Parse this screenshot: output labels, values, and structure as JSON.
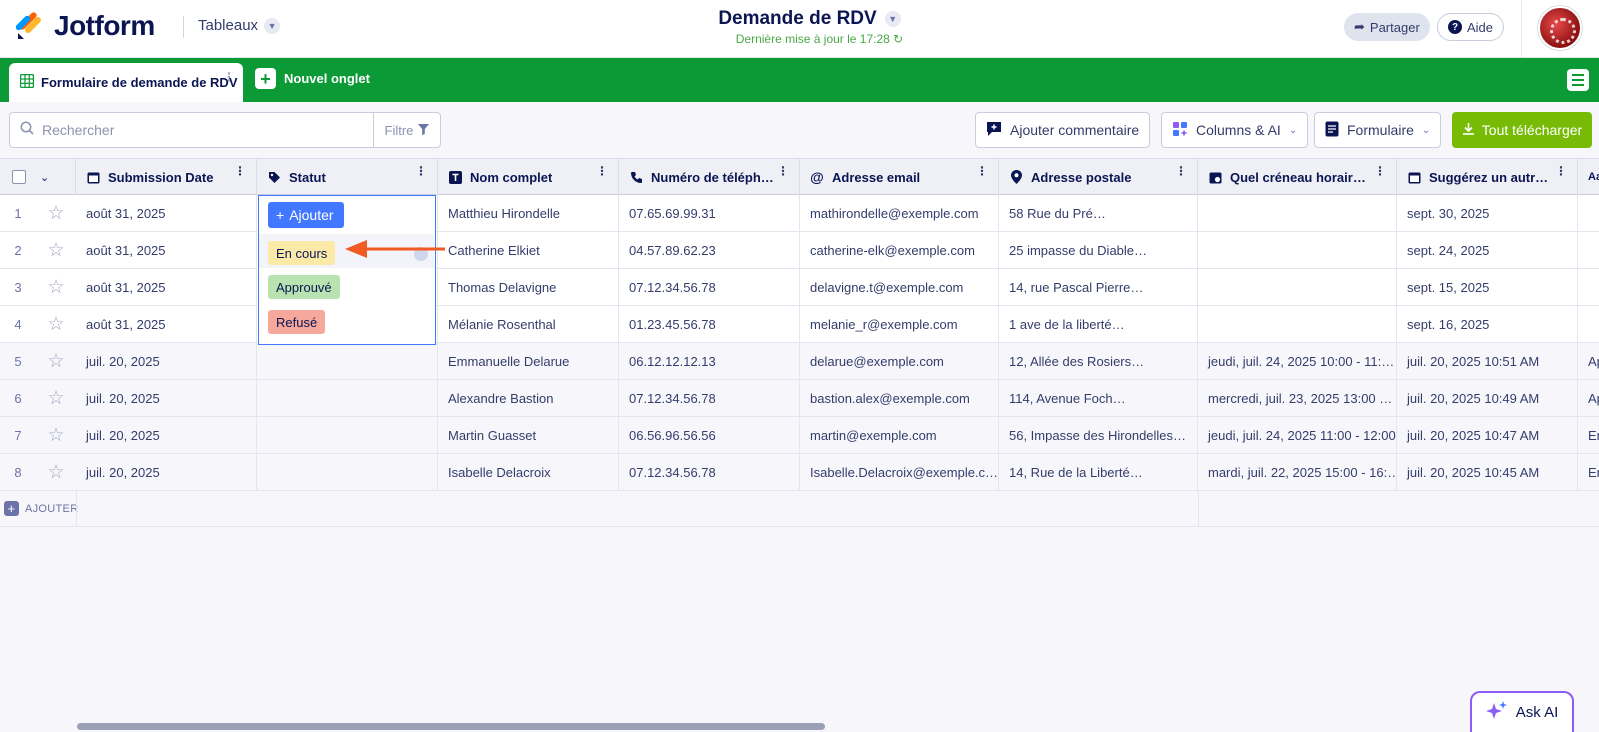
{
  "app": {
    "brand": "Jotform",
    "section": "Tableaux"
  },
  "doc": {
    "title": "Demande de RDV",
    "subtitle": "Dernière mise à jour le 17:28"
  },
  "header": {
    "share_label": "Partager",
    "help_label": "Aide"
  },
  "tabs": {
    "active_label": "Formulaire de demande de RDV",
    "new_tab_label": "Nouvel onglet"
  },
  "toolbar": {
    "search_placeholder": "Rechercher",
    "filter_label": "Filtre",
    "comment_label": "Ajouter commentaire",
    "columns_label": "Columns & AI",
    "form_label": "Formulaire",
    "download_label": "Tout télécharger"
  },
  "columns": [
    {
      "label": "Submission Date",
      "icon": "calendar-icon"
    },
    {
      "label": "Statut",
      "icon": "tag-icon"
    },
    {
      "label": "Nom complet",
      "icon": "text-icon"
    },
    {
      "label": "Numéro de téléph…",
      "icon": "phone-icon"
    },
    {
      "label": "Adresse email",
      "icon": "at-icon"
    },
    {
      "label": "Adresse postale",
      "icon": "location-icon"
    },
    {
      "label": "Quel créneau horaire…",
      "icon": "calendar-clock-icon"
    },
    {
      "label": "Suggérez un autr…",
      "icon": "calendar-icon"
    },
    {
      "label": "Aa",
      "icon": ""
    }
  ],
  "rows": [
    {
      "num": "1",
      "date": "août 31, 2025",
      "name": "Matthieu Hirondelle",
      "phone": "07.65.69.99.31",
      "email": "mathirondelle@exemple.com",
      "address": "58 Rue du Pré…",
      "slot": "",
      "suggest": "sept. 30, 2025",
      "extra": ""
    },
    {
      "num": "2",
      "date": "août 31, 2025",
      "name": "Catherine Elkiet",
      "phone": "04.57.89.62.23",
      "email": "catherine-elk@exemple.com",
      "address": "25 impasse du Diable…",
      "slot": "",
      "suggest": "sept. 24, 2025",
      "extra": ""
    },
    {
      "num": "3",
      "date": "août 31, 2025",
      "name": "Thomas Delavigne",
      "phone": "07.12.34.56.78",
      "email": "delavigne.t@exemple.com",
      "address": "14, rue Pascal Pierre…",
      "slot": "",
      "suggest": "sept. 15, 2025",
      "extra": ""
    },
    {
      "num": "4",
      "date": "août 31, 2025",
      "name": "Mélanie Rosenthal",
      "phone": "01.23.45.56.78",
      "email": "melanie_r@exemple.com",
      "address": "1 ave de la liberté…",
      "slot": "",
      "suggest": "sept. 16, 2025",
      "extra": ""
    },
    {
      "num": "5",
      "date": "juil. 20, 2025",
      "name": "Emmanuelle Delarue",
      "phone": "06.12.12.12.13",
      "email": "delarue@exemple.com",
      "address": "12, Allée des Rosiers…",
      "slot": "jeudi, juil. 24, 2025 10:00 - 11:…",
      "suggest": "juil. 20, 2025 10:51 AM",
      "extra": "Ap"
    },
    {
      "num": "6",
      "date": "juil. 20, 2025",
      "name": "Alexandre Bastion",
      "phone": "07.12.34.56.78",
      "email": "bastion.alex@exemple.com",
      "address": "114, Avenue Foch…",
      "slot": "mercredi, juil. 23, 2025 13:00 …",
      "suggest": "juil. 20, 2025 10:49 AM",
      "extra": "Ap"
    },
    {
      "num": "7",
      "date": "juil. 20, 2025",
      "name": "Martin Guasset",
      "phone": "06.56.96.56.56",
      "email": "martin@exemple.com",
      "address": "56, Impasse des Hirondelles…",
      "slot": "jeudi, juil. 24, 2025 11:00 - 12:00",
      "suggest": "juil. 20, 2025 10:47 AM",
      "extra": "En"
    },
    {
      "num": "8",
      "date": "juil. 20, 2025",
      "name": "Isabelle Delacroix",
      "phone": "07.12.34.56.78",
      "email": "Isabelle.Delacroix@exemple.c…",
      "address": "14, Rue de la Liberté…",
      "slot": "mardi, juil. 22, 2025 15:00 - 16:…",
      "suggest": "juil. 20, 2025 10:45 AM",
      "extra": "En"
    }
  ],
  "add_row_label": "AJOUTER",
  "status_dropdown": {
    "add_label": "Ajouter",
    "options": [
      "En cours",
      "Approuvé",
      "Refusé"
    ],
    "colors": [
      "#fbe9a8",
      "#b8e3b1",
      "#f7a89d"
    ]
  },
  "ask_ai_label": "Ask AI",
  "colors": {
    "brand_green": "#0b9a36",
    "download_green": "#78bb07",
    "accent_blue": "#4277ff",
    "arrow_orange": "#f15a22"
  }
}
